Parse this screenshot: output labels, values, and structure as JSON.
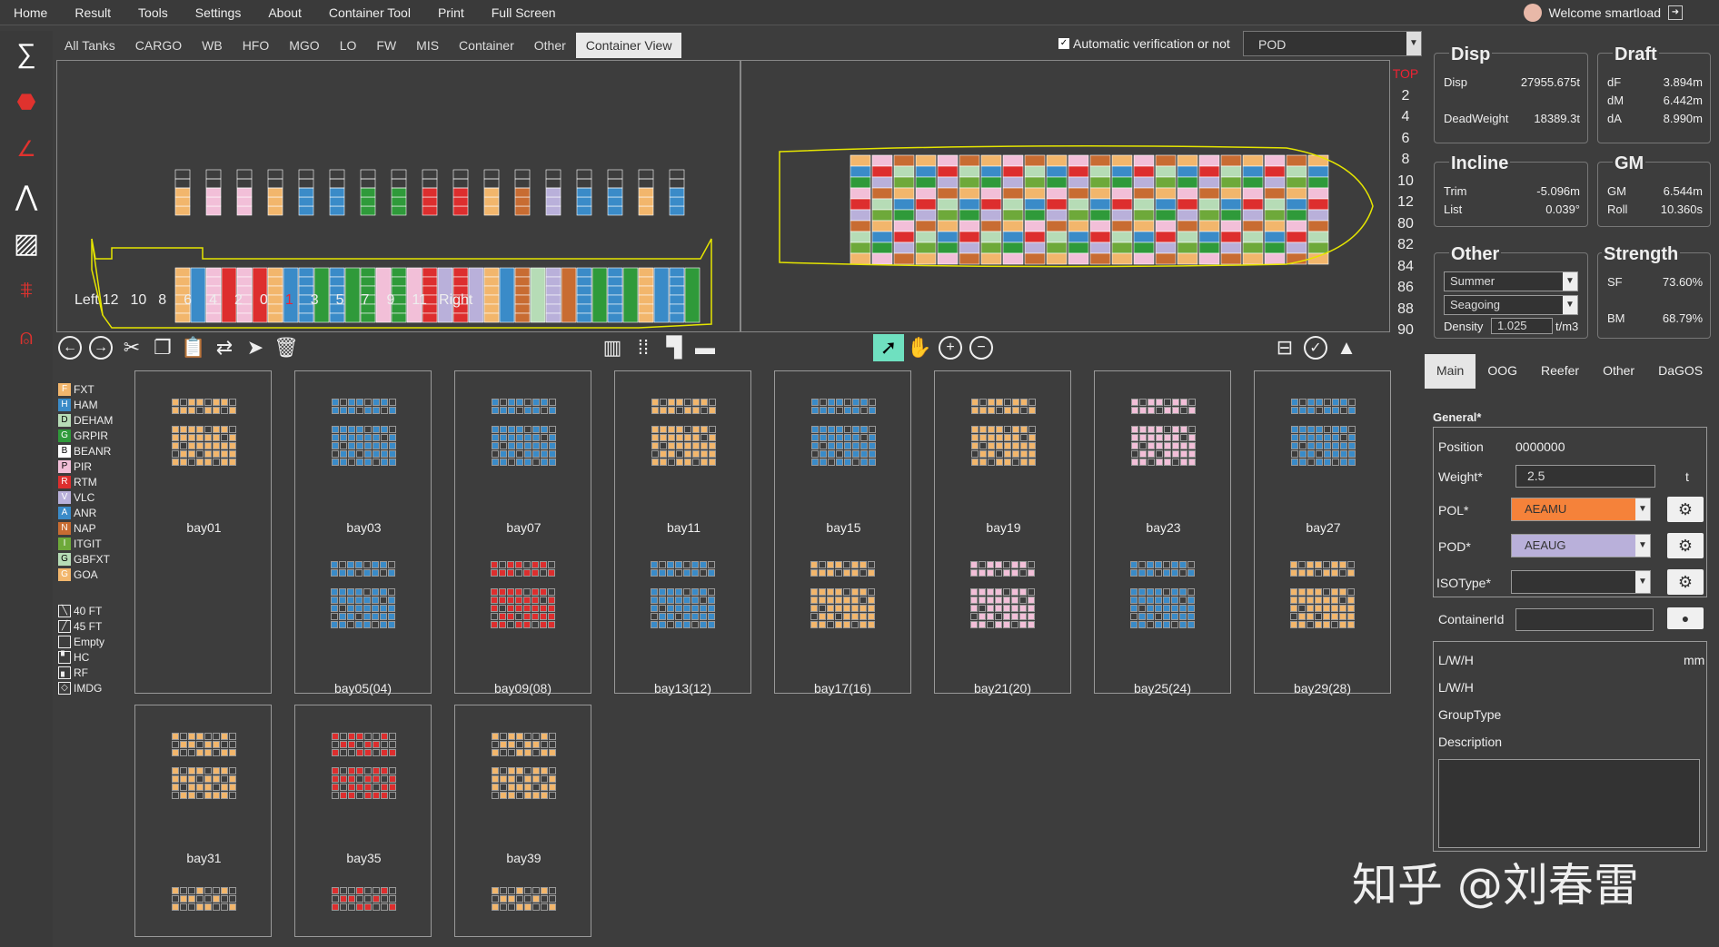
{
  "menu": [
    "Home",
    "Result",
    "Tools",
    "Settings",
    "About",
    "Container Tool",
    "Print",
    "Full Screen"
  ],
  "welcome": "Welcome smartload",
  "tabs": [
    "All Tanks",
    "CARGO",
    "WB",
    "HFO",
    "MGO",
    "LO",
    "FW",
    "MIS",
    "Container",
    "Other",
    "Container View"
  ],
  "auto_verify": "Automatic verification or not",
  "pod_select": "POD",
  "tiers": [
    "TOP",
    "2",
    "4",
    "6",
    "8",
    "10",
    "12",
    "80",
    "82",
    "84",
    "86",
    "88",
    "90"
  ],
  "rows": [
    "Left",
    "12",
    "10",
    "8",
    "6",
    "4",
    "2",
    "0",
    "1",
    "3",
    "5",
    "7",
    "9",
    "11",
    "Right"
  ],
  "legend": [
    {
      "code": "F",
      "name": "FXT",
      "color": "#f2b66c"
    },
    {
      "code": "H",
      "name": "HAM",
      "color": "#3a8bc8"
    },
    {
      "code": "D",
      "name": "DEHAM",
      "color": "#b6dcb6"
    },
    {
      "code": "G",
      "name": "GRPIR",
      "color": "#2f9a3a"
    },
    {
      "code": "B",
      "name": "BEANR",
      "color": "#ffffff"
    },
    {
      "code": "P",
      "name": "PIR",
      "color": "#f2bfd8"
    },
    {
      "code": "R",
      "name": "RTM",
      "color": "#dd2e2e"
    },
    {
      "code": "V",
      "name": "VLC",
      "color": "#b9b0da"
    },
    {
      "code": "A",
      "name": "ANR",
      "color": "#3a8bc8"
    },
    {
      "code": "N",
      "name": "NAP",
      "color": "#c86c32"
    },
    {
      "code": "I",
      "name": "ITGIT",
      "color": "#6ea93a"
    },
    {
      "code": "G",
      "name": "GBFXT",
      "color": "#b6dcb6"
    },
    {
      "code": "G",
      "name": "GOA",
      "color": "#f2b66c"
    }
  ],
  "size_legend": [
    "40 FT",
    "45 FT",
    "Empty",
    "HC",
    "RF",
    "IMDG"
  ],
  "bays": [
    "bay01",
    "bay03",
    "bay07",
    "bay11",
    "bay15",
    "bay19",
    "bay23",
    "bay27",
    "bay05(04)",
    "bay09(08)",
    "bay13(12)",
    "bay17(16)",
    "bay21(20)",
    "bay25(24)",
    "bay29(28)",
    "bay31",
    "bay35",
    "bay39"
  ],
  "disp": {
    "title": "Disp",
    "disp_label": "Disp",
    "disp": "27955.675t",
    "dw_label": "DeadWeight",
    "dw": "18389.3t"
  },
  "draft": {
    "title": "Draft",
    "dF": "3.894m",
    "dM": "6.442m",
    "dA": "8.990m"
  },
  "incline": {
    "title": "Incline",
    "trim_label": "Trim",
    "trim": "-5.096m",
    "list_label": "List",
    "list": "0.039°"
  },
  "gm": {
    "title": "GM",
    "gm_label": "GM",
    "gm": "6.544m",
    "roll_label": "Roll",
    "roll": "10.360s"
  },
  "other": {
    "title": "Other",
    "season": "Summer",
    "condition": "Seagoing",
    "density_label": "Density",
    "density": "1.025",
    "density_unit": "t/m3"
  },
  "strength": {
    "title": "Strength",
    "sf_label": "SF",
    "sf": "73.60%",
    "bm_label": "BM",
    "bm": "68.79%"
  },
  "rtabs": [
    "Main",
    "OOG",
    "Reefer",
    "Other",
    "DaGOS"
  ],
  "general": {
    "title": "General*",
    "position_label": "Position",
    "position": "0000000",
    "weight_label": "Weight*",
    "weight": "2.5",
    "weight_unit": "t",
    "pol_label": "POL*",
    "pol": "AEAMU",
    "pod_label": "POD*",
    "pod": "AEAUG",
    "iso_label": "ISOType*",
    "cid_label": "ContainerId",
    "lwh_label": "L/W/H",
    "lwh_unit": "mm",
    "lwh2_label": "L/W/H",
    "group_label": "GroupType",
    "desc_label": "Description"
  },
  "watermark": "知乎 @刘春雷",
  "colors": {
    "pol": "#f5823a",
    "pod": "#b9b0da",
    "accent_red": "#e23"
  }
}
